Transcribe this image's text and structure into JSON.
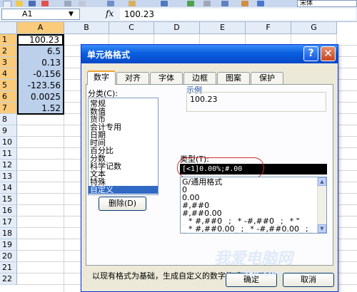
{
  "toolbar": {
    "font_name": "宋体"
  },
  "formula_bar": {
    "name_box": "A1",
    "fx": "fx",
    "value": "100.23"
  },
  "sheet": {
    "columns": [
      "A",
      "B",
      "C",
      "D",
      "E",
      "F",
      "G"
    ],
    "rows": [
      "1",
      "2",
      "3",
      "4",
      "5",
      "6",
      "7",
      "8",
      "9",
      "10",
      "11",
      "12",
      "13",
      "14",
      "15",
      "16",
      "17",
      "18",
      "19",
      "20",
      "21",
      "22"
    ],
    "cells_a": [
      "100.23",
      "6.5",
      "0.13",
      "-0.156",
      "-123.56",
      "0.0025",
      "1.52"
    ]
  },
  "dialog": {
    "title": "单元格格式",
    "help": "?",
    "close": "✕",
    "tabs": [
      "数字",
      "对齐",
      "字体",
      "边框",
      "图案",
      "保护"
    ],
    "category_label": "分类(C):",
    "categories": [
      "常规",
      "数值",
      "货币",
      "会计专用",
      "日期",
      "时间",
      "百分比",
      "分数",
      "科学记数",
      "文本",
      "特殊",
      "自定义"
    ],
    "sample_label": "示例",
    "sample_value": "100.23",
    "type_label": "类型(T):",
    "type_value": "[<1]0.00%;#.00",
    "type_list": [
      "G/通用格式",
      "0",
      "0.00",
      "#,##0",
      "#,##0.00",
      "_ * #,##0_ ;_ * -#,##0_ ;_ * \"",
      "_ * #,##0.00_ ;_ * -#,##0.00_ ;_"
    ],
    "delete_button": "删除(D)",
    "description": "以现有格式为基础，生成自定义的数字格式。",
    "ok_button": "确定",
    "cancel_button": "取消"
  },
  "watermark": {
    "line1": "我爱电脑网",
    "line2": "5ajc.com"
  }
}
